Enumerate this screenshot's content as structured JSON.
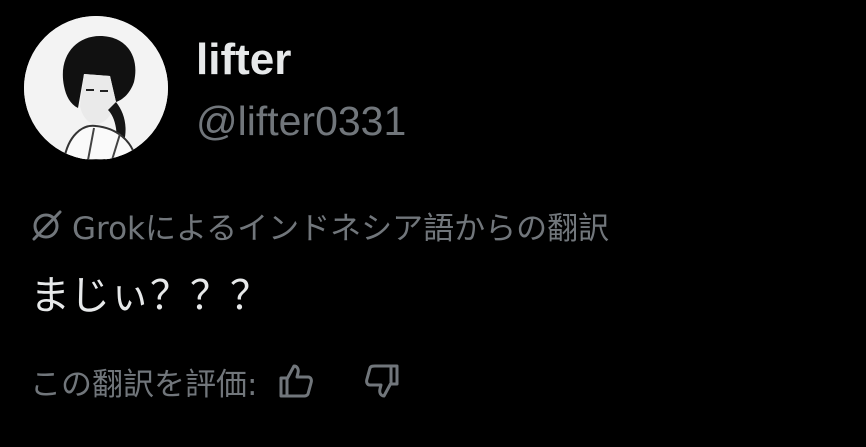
{
  "author": {
    "display_name": "lifter",
    "handle": "@lifter0331"
  },
  "translation_note": {
    "icon": "grok-icon",
    "text": "Grokによるインドネシア語からの翻訳"
  },
  "tweet": {
    "text": "まじぃ？？？"
  },
  "rating": {
    "label": "この翻訳を評価:",
    "thumbs_up_icon": "thumbs-up-icon",
    "thumbs_down_icon": "thumbs-down-icon"
  },
  "colors": {
    "background": "#000000",
    "primary_text": "#e7e9ea",
    "secondary_text": "#71767b"
  }
}
